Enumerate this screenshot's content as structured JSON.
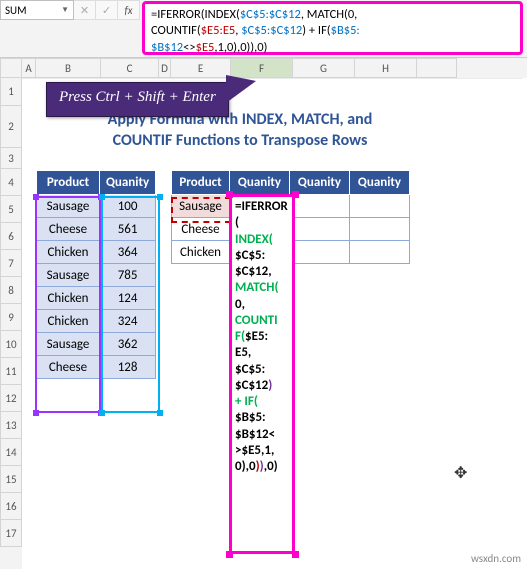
{
  "nameBox": "SUM",
  "formulaBar": {
    "line1_a": "=IFERROR(INDEX(",
    "line1_ref1": "$C$5:$C$12",
    "line1_b": ", MATCH(0,",
    "line2_a": "COUNTIF(",
    "line2_ref2": "$E5:E5",
    "line2_b": ", ",
    "line2_ref1": "$C$5:$C$12",
    "line2_c": ") + IF(",
    "line2_ref3": "$B$5:",
    "line3_ref3": "$B$12",
    "line3_a": "<>",
    "line3_ref4": "$E5",
    "line3_b": ",1,0),0)),0)"
  },
  "columns": [
    "A",
    "B",
    "C",
    "D",
    "E",
    "F",
    "G",
    "H"
  ],
  "rows": [
    "1",
    "2",
    "3",
    "4",
    "5",
    "6",
    "7",
    "8",
    "9",
    "10",
    "11",
    "12",
    "13",
    "14",
    "15",
    "16",
    "17"
  ],
  "callout": "Press Ctrl + Shift + Enter",
  "title1": "Apply Formula with INDEX, MATCH, and",
  "title2": "COUNTIF Functions to Transpose Rows",
  "table1": {
    "headers": [
      "Product",
      "Quanity"
    ],
    "rows": [
      [
        "Sausage",
        "100"
      ],
      [
        "Cheese",
        "561"
      ],
      [
        "Chicken",
        "364"
      ],
      [
        "Sausage",
        "785"
      ],
      [
        "Chicken",
        "124"
      ],
      [
        "Chicken",
        "324"
      ],
      [
        "Sausage",
        "362"
      ],
      [
        "Cheese",
        "128"
      ]
    ]
  },
  "table2": {
    "headers": [
      "Product",
      "Quanity",
      "Quanity",
      "Quanity"
    ],
    "rows": [
      [
        "Sausage",
        "",
        "",
        ""
      ],
      [
        "Cheese",
        "",
        "",
        ""
      ],
      [
        "Chicken",
        "",
        "",
        ""
      ]
    ]
  },
  "editText": {
    "t1": "=IFERR",
    "t2": "OR(",
    "t3": "INDEX(",
    "t4": "$C$5:",
    "t5": "$C$12,",
    "t6": "MATCH(",
    "t7": "0,",
    "t8": "COUNTI",
    "t9": "F(",
    "t10": "$E5:",
    "t11": "E5,",
    "t12": "$C$5:",
    "t13": "$C$12",
    "t14": ")",
    "t15": " + IF(",
    "t16": "$B$5:",
    "t17": "$B$12",
    "t18": "<",
    "t19": ">",
    "t20": "$E5",
    "t21": ",1,",
    "t22": "0)",
    "t23": ",0",
    "t24": ")",
    "t25": ")",
    "t26": ",0)"
  },
  "watermark": "wsxdn.com"
}
